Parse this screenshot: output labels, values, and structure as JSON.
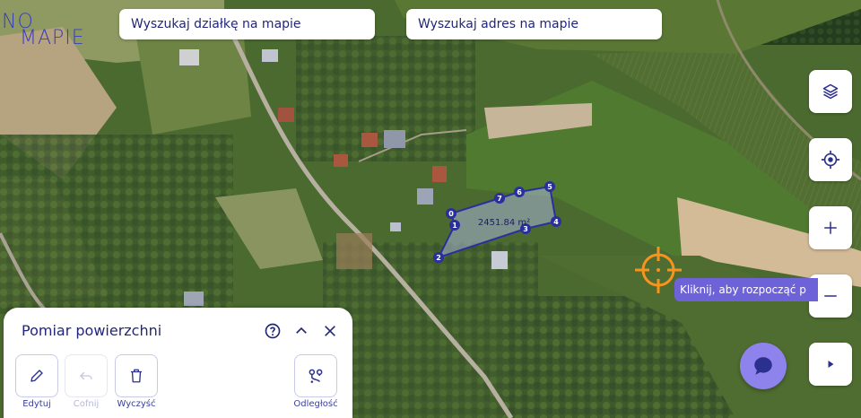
{
  "logo": {
    "line1": "NO",
    "line2": "MAPIE"
  },
  "search": {
    "parcel_placeholder": "Wyszukaj działkę na mapie",
    "address_placeholder": "Wyszukaj adres na mapie"
  },
  "map": {
    "area_label": "2451.84 m²",
    "vertices": [
      "0",
      "1",
      "2",
      "3",
      "4",
      "5",
      "6",
      "7"
    ],
    "tooltip": "Kliknij, aby rozpocząć p",
    "accent_color": "#f7941d",
    "polygon_color": "#2a2f9e"
  },
  "controls": {
    "layers": "layers-icon",
    "locate": "locate-icon",
    "zoom_in": "plus-icon",
    "zoom_out": "minus-icon",
    "expand": "play-icon"
  },
  "panel": {
    "title": "Pomiar powierzchni",
    "tools": {
      "edit": "Edytuj",
      "undo": "Cofnij",
      "clear": "Wyczyść",
      "distance": "Odległość"
    }
  }
}
